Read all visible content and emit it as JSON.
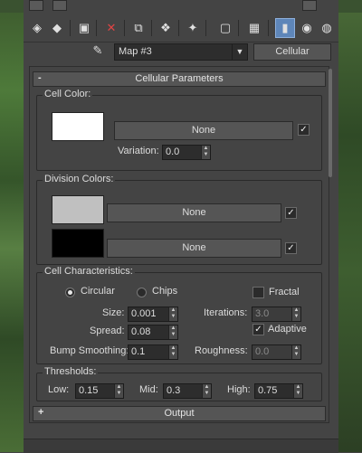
{
  "toolbar": {
    "buttons": [
      {
        "icon": "get-material-icon",
        "glyph": "◈"
      },
      {
        "icon": "put-to-scene-icon",
        "glyph": "◆"
      },
      {
        "icon": "assign-material-icon",
        "glyph": "▣"
      },
      {
        "icon": "delete-icon",
        "glyph": "✕"
      },
      {
        "icon": "copy-material-icon",
        "glyph": "⧉"
      },
      {
        "icon": "make-unique-icon",
        "glyph": "❖"
      },
      {
        "icon": "put-to-library-icon",
        "glyph": "✦"
      },
      {
        "icon": "material-id-channel-icon",
        "glyph": "▢"
      },
      {
        "icon": "show-map-icon",
        "glyph": "▦"
      },
      {
        "icon": "show-end-result-icon",
        "glyph": "▮"
      },
      {
        "icon": "go-to-parent-icon",
        "glyph": "◉"
      },
      {
        "icon": "go-forward-icon",
        "glyph": "◍"
      }
    ]
  },
  "name_row": {
    "map_name": "Map #3",
    "map_type": "Cellular"
  },
  "rollouts": {
    "cellular": {
      "sign": "-",
      "title": "Cellular Parameters"
    },
    "output": {
      "sign": "+",
      "title": "Output"
    }
  },
  "cell_color": {
    "group_label": "Cell Color:",
    "swatch_color": "#ffffff",
    "map_label": "None",
    "map_enabled": "✓",
    "variation_label": "Variation:",
    "variation_value": "0.0"
  },
  "division_colors": {
    "group_label": "Division Colors:",
    "color1": "#c0c0c0",
    "color1_map": "None",
    "color1_enabled": "✓",
    "color2": "#000000",
    "color2_map": "None",
    "color2_enabled": "✓"
  },
  "cell_characteristics": {
    "group_label": "Cell Characteristics:",
    "circular_label": "Circular",
    "chips_label": "Chips",
    "fractal_label": "Fractal",
    "size_label": "Size:",
    "size_value": "0.001",
    "spread_label": "Spread:",
    "spread_value": "0.08",
    "bump_label": "Bump Smoothing:",
    "bump_value": "0.1",
    "iterations_label": "Iterations:",
    "iterations_value": "3.0",
    "adaptive_label": "Adaptive",
    "adaptive_check": "✓",
    "roughness_label": "Roughness:",
    "roughness_value": "0.0"
  },
  "thresholds": {
    "group_label": "Thresholds:",
    "low_label": "Low:",
    "low_value": "0.15",
    "mid_label": "Mid:",
    "mid_value": "0.3",
    "high_label": "High:",
    "high_value": "0.75"
  }
}
